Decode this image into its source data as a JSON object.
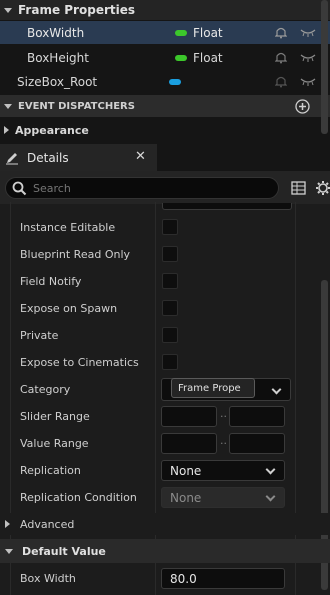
{
  "variables": {
    "category_title": "Frame Properties",
    "items": [
      {
        "name": "BoxWidth",
        "type": "Float",
        "type_color": "#3cc72b"
      },
      {
        "name": "BoxHeight",
        "type": "Float",
        "type_color": "#3cc72b"
      }
    ],
    "sizebox": {
      "name": "SizeBox_Root",
      "pill_color": "#1a9fe0"
    }
  },
  "event_dispatchers": {
    "title": "EVENT DISPATCHERS"
  },
  "appearance": {
    "title": "Appearance"
  },
  "details_tab": {
    "title": "Details"
  },
  "search": {
    "placeholder": "Search"
  },
  "properties": {
    "instance_editable": "Instance Editable",
    "blueprint_read_only": "Blueprint Read Only",
    "field_notify": "Field Notify",
    "expose_on_spawn": "Expose on Spawn",
    "private": "Private",
    "expose_to_cinematics": "Expose to Cinematics",
    "category": "Category",
    "category_value": "Frame Prope",
    "slider_range": "Slider Range",
    "value_range": "Value Range",
    "replication": "Replication",
    "replication_value": "None",
    "replication_condition": "Replication Condition",
    "replication_condition_value": "None"
  },
  "advanced": {
    "title": "Advanced"
  },
  "default_value": {
    "title": "Default Value",
    "box_width_label": "Box Width",
    "box_width_value": "80.0"
  }
}
